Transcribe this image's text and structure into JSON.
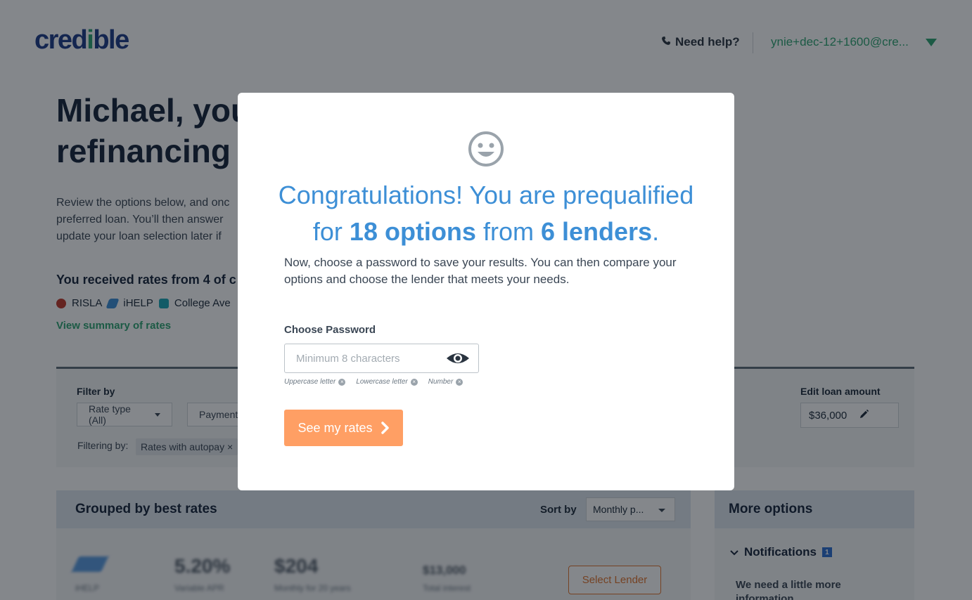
{
  "header": {
    "logo_text": "credible",
    "help_label": "Need help?",
    "account_email": "ynie+dec-12+1600@cre..."
  },
  "main": {
    "headline": "Michael, you\nrefinancing r",
    "intro": "Review the options below, and onc preferred loan. You'll then answer update your loan selection later if",
    "received_title": "You received rates from 4 of c",
    "lenders": [
      "RISLA",
      "iHELP",
      "College Ave"
    ],
    "view_summary": "View summary of rates"
  },
  "filters": {
    "title": "Filter by",
    "rate_type": "Rate type (All)",
    "payment": "Payment",
    "filtering_label": "Filtering by:",
    "chip": "Rates with autopay ×",
    "edit_title": "Edit loan amount",
    "loan_amount": "$36,000"
  },
  "grouped": {
    "title": "Grouped by best rates",
    "sort_label": "Sort by",
    "sort_value": "Monthly p...",
    "row_blurred": {
      "lender": "iHELP",
      "apr": "5.20%",
      "apr_label": "Variable APR",
      "monthly": "$204",
      "monthly_label": "Monthly for 20 years",
      "total": "$13,000",
      "total_label": "Total interest"
    },
    "select_button": "Select Lender"
  },
  "more_options": {
    "title": "More options",
    "notifications_label": "Notifications",
    "notifications_count": "1",
    "need_info": "We need a little more information"
  },
  "modal": {
    "headline_line1": "Congratulations! You are prequalified",
    "headline_for": "for",
    "headline_options": "18 options",
    "headline_from": "from",
    "headline_lenders": "6 lenders",
    "headline_end": ".",
    "subtext": "Now, choose a password to save your results. You can then compare your options and choose the lender that meets your needs.",
    "password_label": "Choose Password",
    "password_placeholder": "Minimum 8 characters",
    "requirements": [
      "Uppercase letter",
      "Lowercase letter",
      "Number"
    ],
    "cta_label": "See my rates"
  },
  "colors": {
    "brand_blue": "#1f3c88",
    "brand_green": "#2ea572",
    "modal_blue": "#3d8fd6",
    "cta_orange": "#ff9f64"
  },
  "icons": [
    "phone-icon",
    "caret-down-icon",
    "pencil-icon",
    "smiley-icon",
    "eye-icon",
    "x-circle-icon",
    "chevron-right-icon",
    "chevron-down-icon"
  ]
}
